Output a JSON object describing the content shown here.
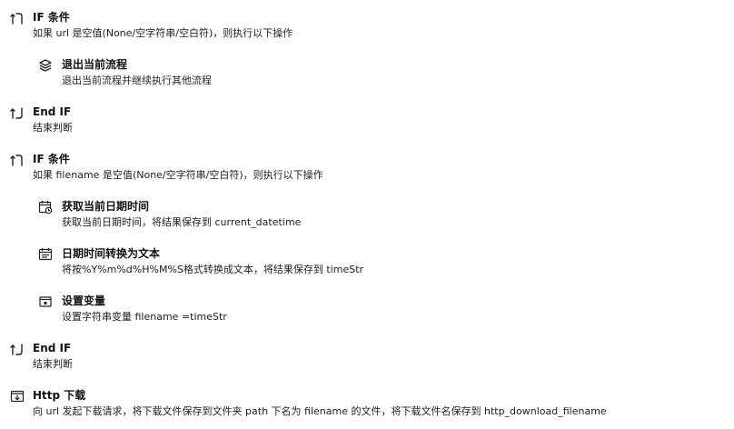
{
  "steps": [
    {
      "icon": "if-branch-icon",
      "title": "IF 条件",
      "desc": "如果  url  是空值(None/空字符串/空白符)，则执行以下操作"
    },
    {
      "icon": "layers-exit-icon",
      "title": "退出当前流程",
      "desc": "退出当前流程并继续执行其他流程"
    },
    {
      "icon": "end-if-icon",
      "title": "End IF",
      "desc": "结束判断"
    },
    {
      "icon": "if-branch-icon",
      "title": "IF 条件",
      "desc": "如果  filename  是空值(None/空字符串/空白符)，则执行以下操作"
    },
    {
      "icon": "calendar-clock-icon",
      "title": "获取当前日期时间",
      "desc": "获取当前日期时间，将结果保存到  current_datetime"
    },
    {
      "icon": "calendar-text-icon",
      "title": "日期时间转换为文本",
      "desc": "将按%Y%m%d%H%M%S格式转换成文本，将结果保存到  timeStr"
    },
    {
      "icon": "variable-box-icon",
      "title": "设置变量",
      "desc": "设置字符串变量  filename  =timeStr"
    },
    {
      "icon": "end-if-icon",
      "title": "End IF",
      "desc": "结束判断"
    },
    {
      "icon": "download-icon",
      "title": "Http 下载",
      "desc": "向  url  发起下载请求，将下载文件保存到文件夹  path  下名为  filename  的文件，将下载文件名保存到  http_download_filename"
    }
  ]
}
